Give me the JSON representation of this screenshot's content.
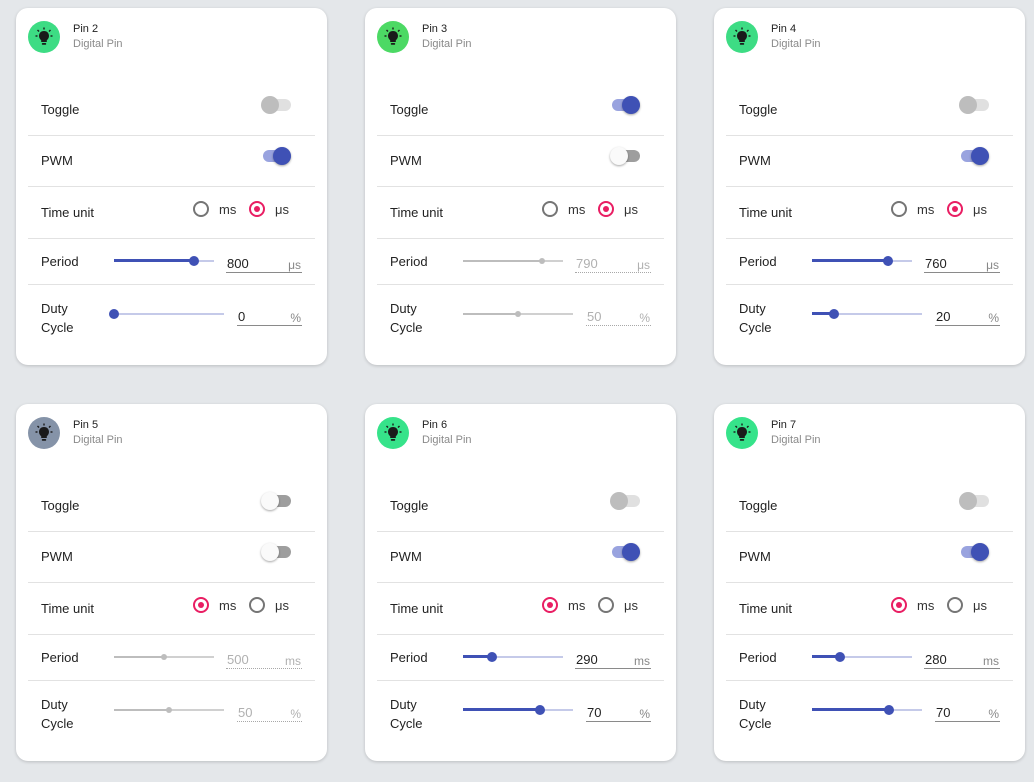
{
  "labels": {
    "toggle": "Toggle",
    "pwm": "PWM",
    "time_unit": "Time unit",
    "period": "Period",
    "duty_line1": "Duty",
    "duty_line2": "Cycle",
    "ms": "ms",
    "us": "μs",
    "percent": "%"
  },
  "colors": {
    "accent": "#3f51b5",
    "radio_selected": "#e91e63",
    "background": "#e4e7ea"
  },
  "cards": [
    {
      "pin_name": "Pin 2",
      "pin_type": "Digital Pin",
      "avatar_color": "#3ddc84",
      "icon": "lightbulb-icon",
      "toggle": "disabled",
      "pwm": "on",
      "time_unit": "μs",
      "period_value": "800",
      "period_unit": "μs",
      "period_fraction": 0.8,
      "period_enabled": true,
      "duty_value": "0",
      "duty_unit": "%",
      "duty_fraction": 0.0,
      "duty_enabled": true
    },
    {
      "pin_name": "Pin 3",
      "pin_type": "Digital Pin",
      "avatar_color": "#4cd964",
      "icon": "lightbulb-icon",
      "toggle": "on",
      "pwm": "off",
      "time_unit": "μs",
      "period_value": "790",
      "period_unit": "μs",
      "period_fraction": 0.79,
      "period_enabled": false,
      "duty_value": "50",
      "duty_unit": "%",
      "duty_fraction": 0.5,
      "duty_enabled": false
    },
    {
      "pin_name": "Pin 4",
      "pin_type": "Digital Pin",
      "avatar_color": "#3ddc84",
      "icon": "lightbulb-icon",
      "toggle": "disabled",
      "pwm": "on",
      "time_unit": "μs",
      "period_value": "760",
      "period_unit": "μs",
      "period_fraction": 0.76,
      "period_enabled": true,
      "duty_value": "20",
      "duty_unit": "%",
      "duty_fraction": 0.2,
      "duty_enabled": true
    },
    {
      "pin_name": "Pin 5",
      "pin_type": "Digital Pin",
      "avatar_color": "#8593a8",
      "icon": "lightbulb-icon",
      "toggle": "off",
      "pwm": "off",
      "time_unit": "ms",
      "period_value": "500",
      "period_unit": "ms",
      "period_fraction": 0.5,
      "period_enabled": false,
      "duty_value": "50",
      "duty_unit": "%",
      "duty_fraction": 0.5,
      "duty_enabled": false
    },
    {
      "pin_name": "Pin 6",
      "pin_type": "Digital Pin",
      "avatar_color": "#36e38a",
      "icon": "lightbulb-icon",
      "toggle": "disabled",
      "pwm": "on",
      "time_unit": "ms",
      "period_value": "290",
      "period_unit": "ms",
      "period_fraction": 0.29,
      "period_enabled": true,
      "duty_value": "70",
      "duty_unit": "%",
      "duty_fraction": 0.7,
      "duty_enabled": true
    },
    {
      "pin_name": "Pin 7",
      "pin_type": "Digital Pin",
      "avatar_color": "#36e38a",
      "icon": "lightbulb-icon",
      "toggle": "disabled",
      "pwm": "on",
      "time_unit": "ms",
      "period_value": "280",
      "period_unit": "ms",
      "period_fraction": 0.28,
      "period_enabled": true,
      "duty_value": "70",
      "duty_unit": "%",
      "duty_fraction": 0.7,
      "duty_enabled": true
    }
  ]
}
